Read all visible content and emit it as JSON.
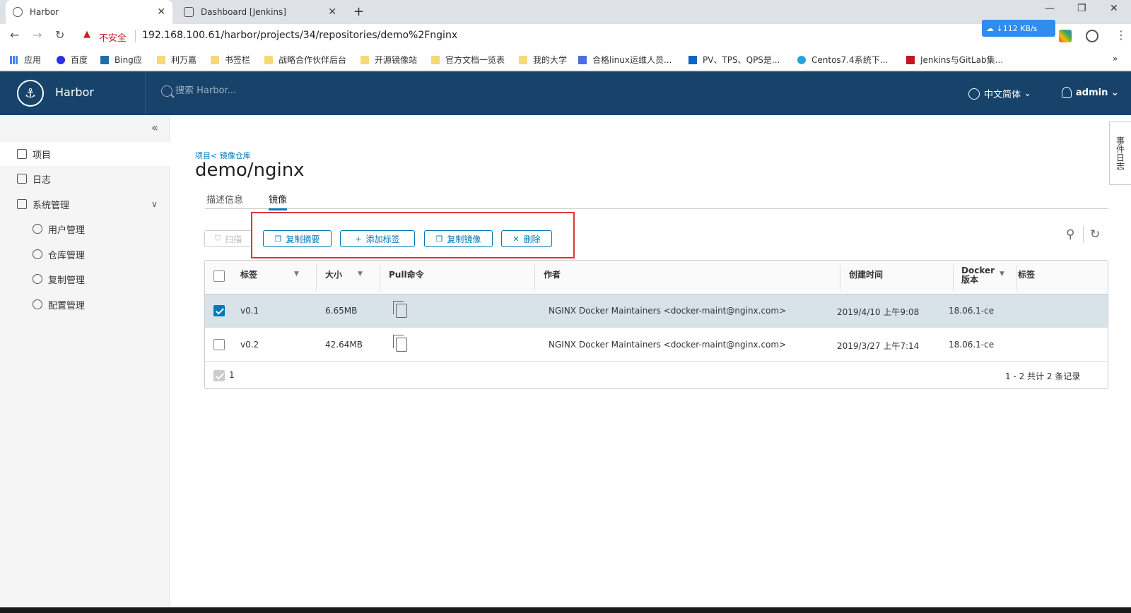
{
  "browser": {
    "tabs": [
      {
        "title": "Harbor",
        "active": true
      },
      {
        "title": "Dashboard [Jenkins]",
        "active": false
      }
    ],
    "insecure_label": "不安全",
    "url": "192.168.100.61/harbor/projects/34/repositories/demo%2Fnginx",
    "speed": "112 KB/s",
    "bookmarks": [
      "应用",
      "百度",
      "Bing应",
      "利万嘉",
      "书签栏",
      "战略合作伙伴后台",
      "开源镜像站",
      "官方文档一览表",
      "我的大学",
      "合格linux运维人员...",
      "PV、TPS、QPS是...",
      "Centos7.4系统下...",
      "Jenkins与GitLab集..."
    ]
  },
  "header": {
    "brand": "Harbor",
    "search_placeholder": "搜索 Harbor...",
    "language": "中文简体",
    "user": "admin"
  },
  "sidebar": {
    "items": [
      {
        "label": "项目",
        "active": true
      },
      {
        "label": "日志"
      },
      {
        "label": "系统管理"
      }
    ],
    "sub_items": [
      "用户管理",
      "仓库管理",
      "复制管理",
      "配置管理"
    ]
  },
  "main": {
    "breadcrumb": "项目< 镜像仓库",
    "title": "demo/nginx",
    "tabs": [
      "描述信息",
      "镜像"
    ],
    "toolbar": {
      "scan": "扫描",
      "copy_digest": "复制摘要",
      "add_label": "添加标签",
      "copy_image": "复制镜像",
      "delete": "删除"
    },
    "columns": [
      "标签",
      "大小",
      "Pull命令",
      "作者",
      "创建时间",
      "Docker",
      "版本",
      "标签"
    ],
    "rows": [
      {
        "tag": "v0.1",
        "size": "6.65MB",
        "author": "NGINX Docker Maintainers <docker-maint@nginx.com>",
        "created": "2019/4/10 上午9:08",
        "docker": "18.06.1-ce",
        "selected": true
      },
      {
        "tag": "v0.2",
        "size": "42.64MB",
        "author": "NGINX Docker Maintainers <docker-maint@nginx.com>",
        "created": "2019/3/27 上午7:14",
        "docker": "18.06.1-ce",
        "selected": false
      }
    ],
    "footer_count": "1",
    "footer_summary": "1 - 2 共计 2 条记录"
  },
  "side_tab": "事件日志"
}
